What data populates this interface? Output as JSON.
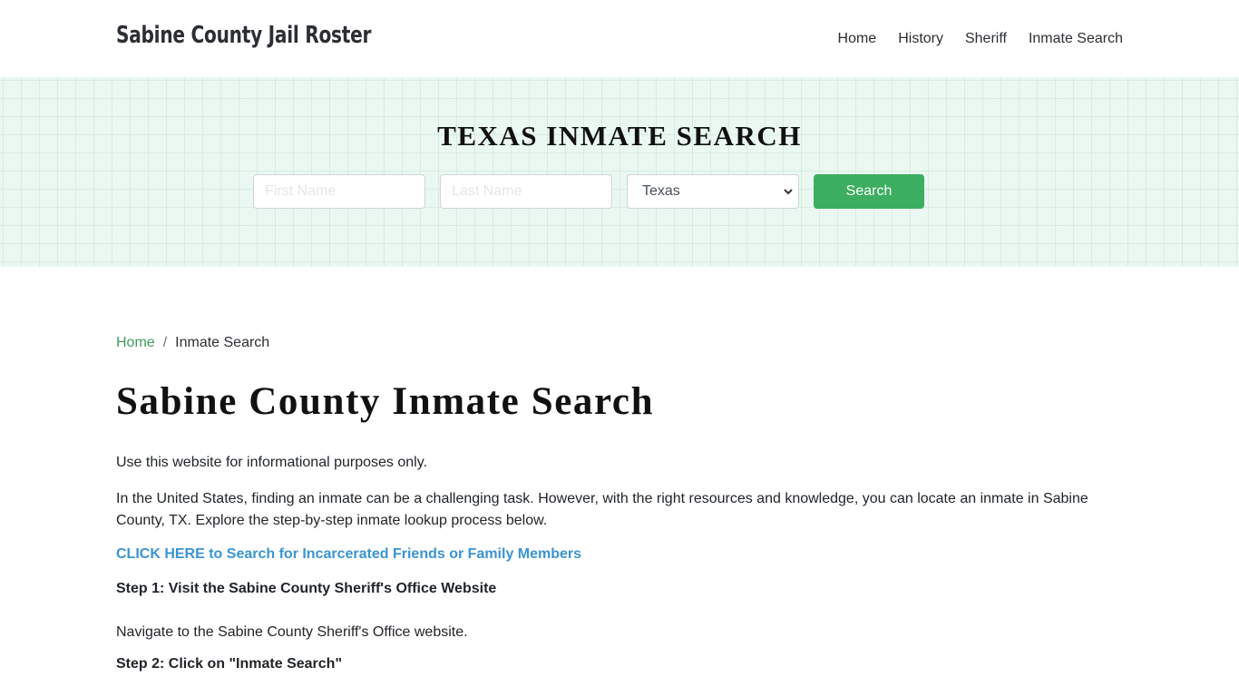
{
  "header": {
    "brand": "Sabine County Jail Roster",
    "nav": [
      {
        "label": "Home"
      },
      {
        "label": "History"
      },
      {
        "label": "Sheriff"
      },
      {
        "label": "Inmate Search"
      }
    ]
  },
  "hero": {
    "title": "TEXAS INMATE SEARCH",
    "form": {
      "first_name_placeholder": "First Name",
      "first_name_value": "",
      "last_name_placeholder": "Last Name",
      "last_name_value": "",
      "state_selected": "Texas",
      "search_label": "Search"
    }
  },
  "breadcrumb": {
    "home": "Home",
    "separator": "/",
    "current": "Inmate Search"
  },
  "content": {
    "title": "Sabine County Inmate Search",
    "paragraphs": [
      "Use this website for informational purposes only.",
      "In the United States, finding an inmate can be a challenging task. However, with the right resources and knowledge, you can locate an inmate in Sabine County, TX. Explore the step-by-step inmate lookup process below."
    ],
    "cta_link": "CLICK HERE to Search for Incarcerated Friends or Family Members",
    "steps": [
      {
        "heading": "Step 1: Visit the Sabine County Sheriff's Office Website",
        "text": "Navigate to the Sabine County Sheriff's Office website."
      },
      {
        "heading": "Step 2: Click on \"Inmate Search\""
      }
    ]
  },
  "colors": {
    "accent_green": "#3cae5f",
    "link_blue": "#3b94d1",
    "hero_bg": "#eaf8f1",
    "breadcrumb_link": "#3f9b5d"
  }
}
